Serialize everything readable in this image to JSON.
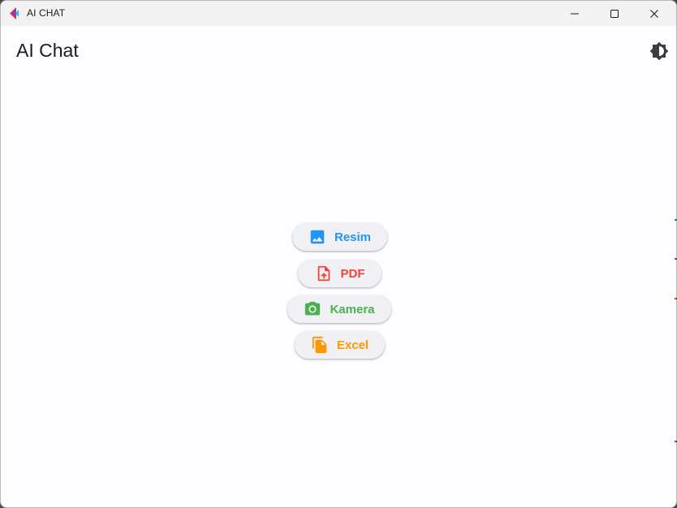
{
  "window": {
    "title": "AI CHAT"
  },
  "appbar": {
    "title": "AI Chat",
    "theme_toggle_icon": "brightness-icon"
  },
  "actions": [
    {
      "label": "Resim",
      "icon": "image-icon",
      "color": "#2196f3"
    },
    {
      "label": "PDF",
      "icon": "upload-file-icon",
      "color": "#f44336"
    },
    {
      "label": "Kamera",
      "icon": "camera-icon",
      "color": "#4caf50"
    },
    {
      "label": "Excel",
      "icon": "copy-files-icon",
      "color": "#ff9800"
    }
  ],
  "colors": {
    "background": "#fdfcff",
    "titlebar": "#f3f3f3",
    "button_bg": "#f1f0f5"
  }
}
